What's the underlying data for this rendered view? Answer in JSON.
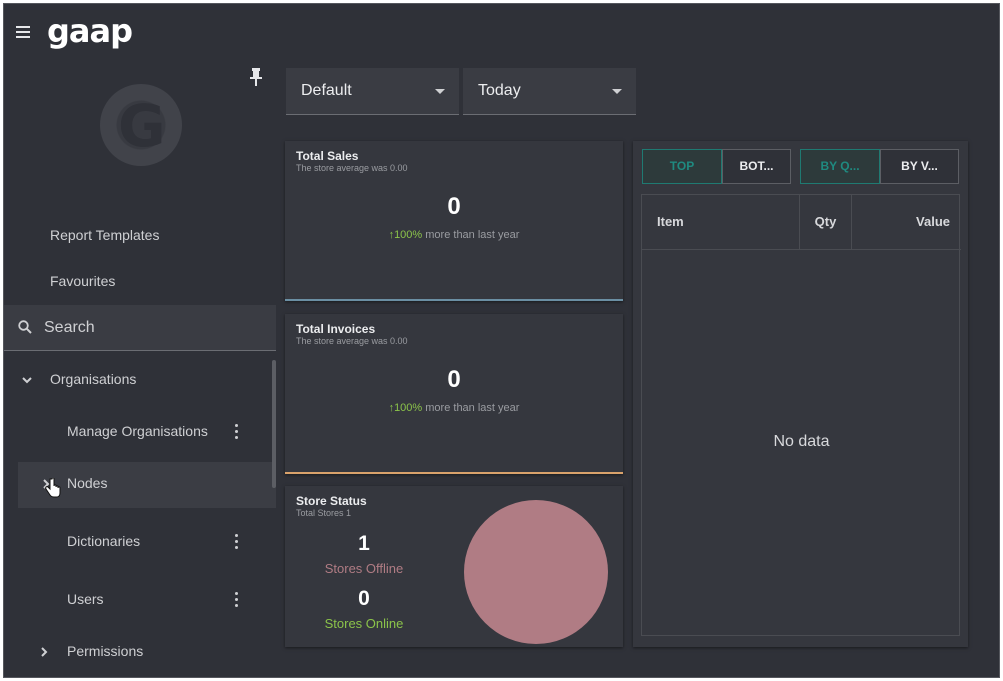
{
  "app": {
    "brand": "gaap"
  },
  "sidebar": {
    "report_templates": "Report Templates",
    "favourites": "Favourites",
    "search_label": "Search",
    "nav": {
      "organisations": "Organisations",
      "manage_organisations": "Manage Organisations",
      "nodes": "Nodes",
      "dictionaries": "Dictionaries",
      "users": "Users",
      "permissions": "Permissions"
    }
  },
  "filters": {
    "profile": "Default",
    "period": "Today"
  },
  "cards": {
    "total_sales": {
      "title": "Total Sales",
      "subtitle": "The store average was 0.00",
      "value": "0",
      "trend_pct": "100%",
      "trend_text": "more than last year"
    },
    "total_invoices": {
      "title": "Total Invoices",
      "subtitle": "The store average was 0.00",
      "value": "0",
      "trend_pct": "100%",
      "trend_text": "more than last year"
    },
    "store_status": {
      "title": "Store Status",
      "subtitle": "Total Stores 1",
      "offline_count": "1",
      "offline_label": "Stores Offline",
      "online_count": "0",
      "online_label": "Stores Online",
      "pie": {
        "offline": 1,
        "online": 0
      }
    }
  },
  "ranking": {
    "buttons": {
      "top": "TOP",
      "bottom": "BOT...",
      "by_qty": "BY Q...",
      "by_value": "BY V..."
    },
    "columns": {
      "item": "Item",
      "qty": "Qty",
      "value": "Value"
    },
    "empty": "No data"
  },
  "colors": {
    "background": "#2f3138",
    "panel": "#35373e",
    "trend_up": "#8bc34a",
    "offline": "#b07c84",
    "online": "#8bc34a",
    "teal_selected": "#1f8a80",
    "sales_accent": "#6b8fa3",
    "invoices_accent": "#d9a26b"
  },
  "icons": [
    "menu-icon",
    "pin-icon",
    "search-icon",
    "chevron-down-icon",
    "chevron-right-icon",
    "more-vert-icon",
    "arrow-up-icon",
    "pointer-cursor-icon"
  ]
}
